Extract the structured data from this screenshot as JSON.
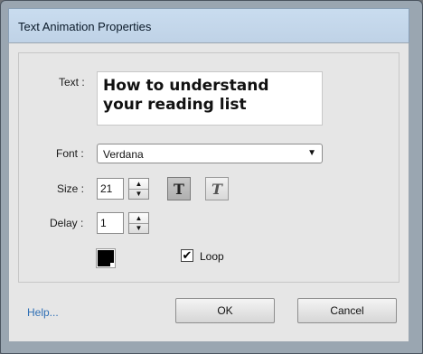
{
  "window": {
    "title": "Text Animation Properties"
  },
  "form": {
    "text_label": "Text :",
    "text_value": "How to understand\nyour reading list",
    "font_label": "Font :",
    "font_value": "Verdana",
    "size_label": "Size :",
    "size_value": "21",
    "bold_symbol": "T",
    "italic_symbol": "T",
    "delay_label": "Delay :",
    "delay_value": "1",
    "loop_label": "Loop",
    "loop_checked": true,
    "loop_check_symbol": "✔",
    "text_color": "#000000"
  },
  "footer": {
    "help_label": "Help...",
    "ok_label": "OK",
    "cancel_label": "Cancel"
  }
}
